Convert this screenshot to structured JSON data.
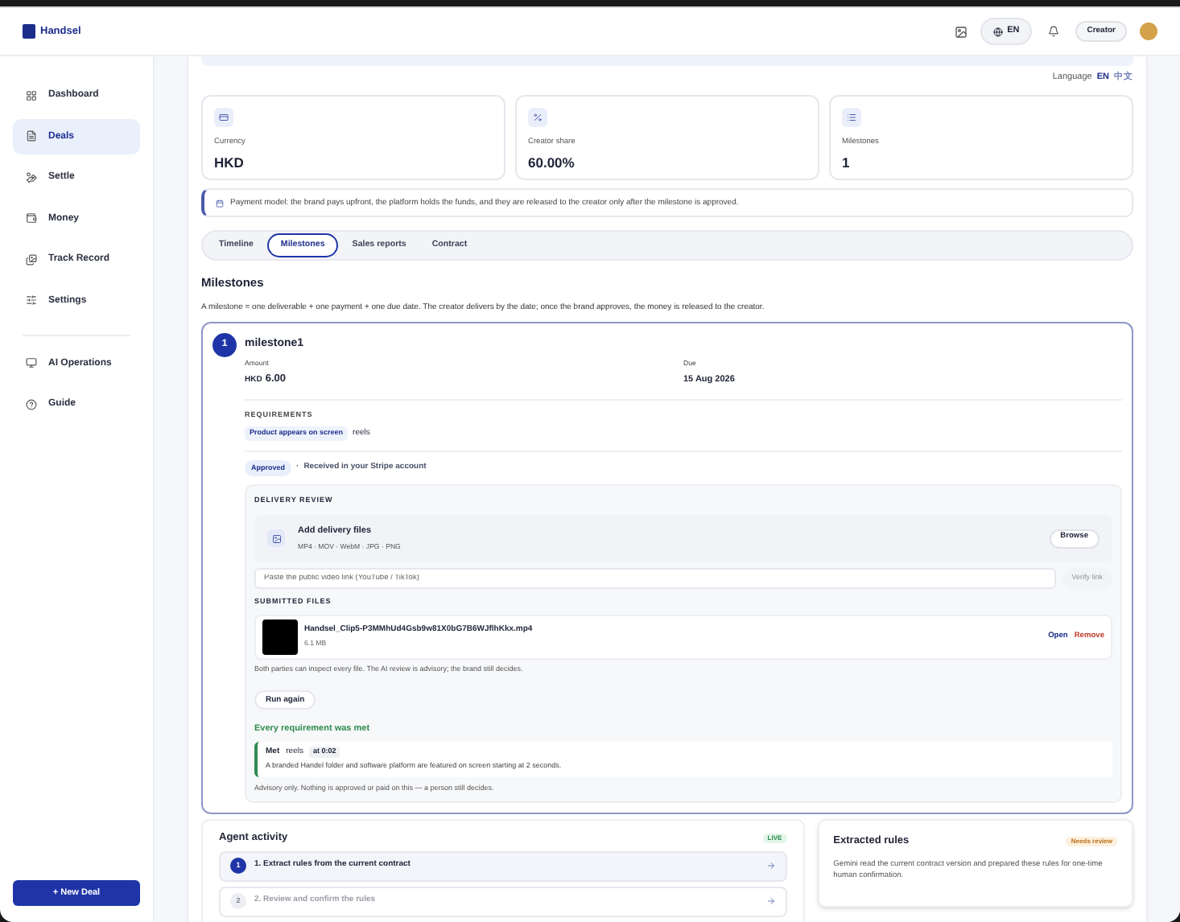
{
  "brand": {
    "name": "Handsel"
  },
  "header": {
    "language": "EN",
    "role": "Creator"
  },
  "sidebar": {
    "sections": [
      [
        {
          "label": "Dashboard",
          "selected": false
        },
        {
          "label": "Deals",
          "selected": true
        },
        {
          "label": "Settle",
          "selected": false
        },
        {
          "label": "Money",
          "selected": false
        },
        {
          "label": "Track Record",
          "selected": false
        },
        {
          "label": "Settings",
          "selected": false
        }
      ],
      [
        {
          "label": "AI Operations",
          "selected": false
        },
        {
          "label": "Guide",
          "selected": false
        }
      ]
    ],
    "new_deal": "+ New Deal"
  },
  "language_switch": {
    "label": "Language",
    "options": [
      {
        "label": "EN",
        "selected": true
      },
      {
        "label": "中文",
        "selected": false
      }
    ]
  },
  "stats": [
    {
      "label": "Currency",
      "value": "HKD"
    },
    {
      "label": "Creator share",
      "value": "60.00%"
    },
    {
      "label": "Milestones",
      "value": "1"
    }
  ],
  "payment_note": "Payment model: the brand pays upfront, the platform holds the funds, and they are released to the creator only after the milestone is approved.",
  "tabs": [
    {
      "label": "Timeline",
      "selected": false
    },
    {
      "label": "Milestones",
      "selected": true
    },
    {
      "label": "Sales reports",
      "selected": false
    },
    {
      "label": "Contract",
      "selected": false
    }
  ],
  "milestones_section": {
    "title": "Milestones",
    "description": "A milestone = one deliverable + one payment + one due date. The creator delivers by the date; once the brand approves, the money is released to the creator."
  },
  "milestone": {
    "number": "1",
    "title": "milestone1",
    "amount_label": "Amount",
    "currency": "HKD",
    "amount": "6.00",
    "due_label": "Due",
    "due": "15 Aug 2026",
    "requirements_label": "REQUIREMENTS",
    "requirements": [
      {
        "tag": "Product appears on screen",
        "text": "reels"
      }
    ],
    "status": "Approved",
    "status_separator": "·",
    "status_note": "Received in your Stripe account",
    "delivery_review": {
      "title": "DELIVERY REVIEW",
      "upload_title": "Add delivery files",
      "upload_formats": "MP4 · MOV · WebM · JPG · PNG",
      "browse": "Browse",
      "link_placeholder": "Paste the public video link (YouTube / TikTok)",
      "verify": "Verify link",
      "verify_disabled": true,
      "submitted_label": "SUBMITTED FILES",
      "files": [
        {
          "name": "Handsel_Clip5-P3MMhUd4Gsb9w81X0bG7B6WJflhKkx.mp4",
          "size": "6.1 MB",
          "open": "Open",
          "remove": "Remove"
        }
      ],
      "note": "Both parties can inspect every file. The AI review is advisory; the brand still decides.",
      "run_again": "Run again",
      "verdict": "Every requirement was met",
      "results": [
        {
          "status": "Met",
          "requirement": "reels",
          "time": "at 0:02",
          "detail": "A branded Handel folder and software platform are featured on screen starting at 2 seconds."
        }
      ],
      "advisory": "Advisory only. Nothing is approved or paid on this — a person still decides."
    }
  },
  "agent_activity": {
    "title": "Agent activity",
    "badge": "LIVE",
    "steps": [
      {
        "number": "1",
        "label": "1. Extract rules from the current contract",
        "active": true
      },
      {
        "number": "2",
        "label": "2. Review and confirm the rules",
        "active": false
      }
    ]
  },
  "extracted_rules": {
    "title": "Extracted rules",
    "badge": "Needs review",
    "text": "Gemini read the current contract version and prepared these rules for one-time human confirmation."
  }
}
